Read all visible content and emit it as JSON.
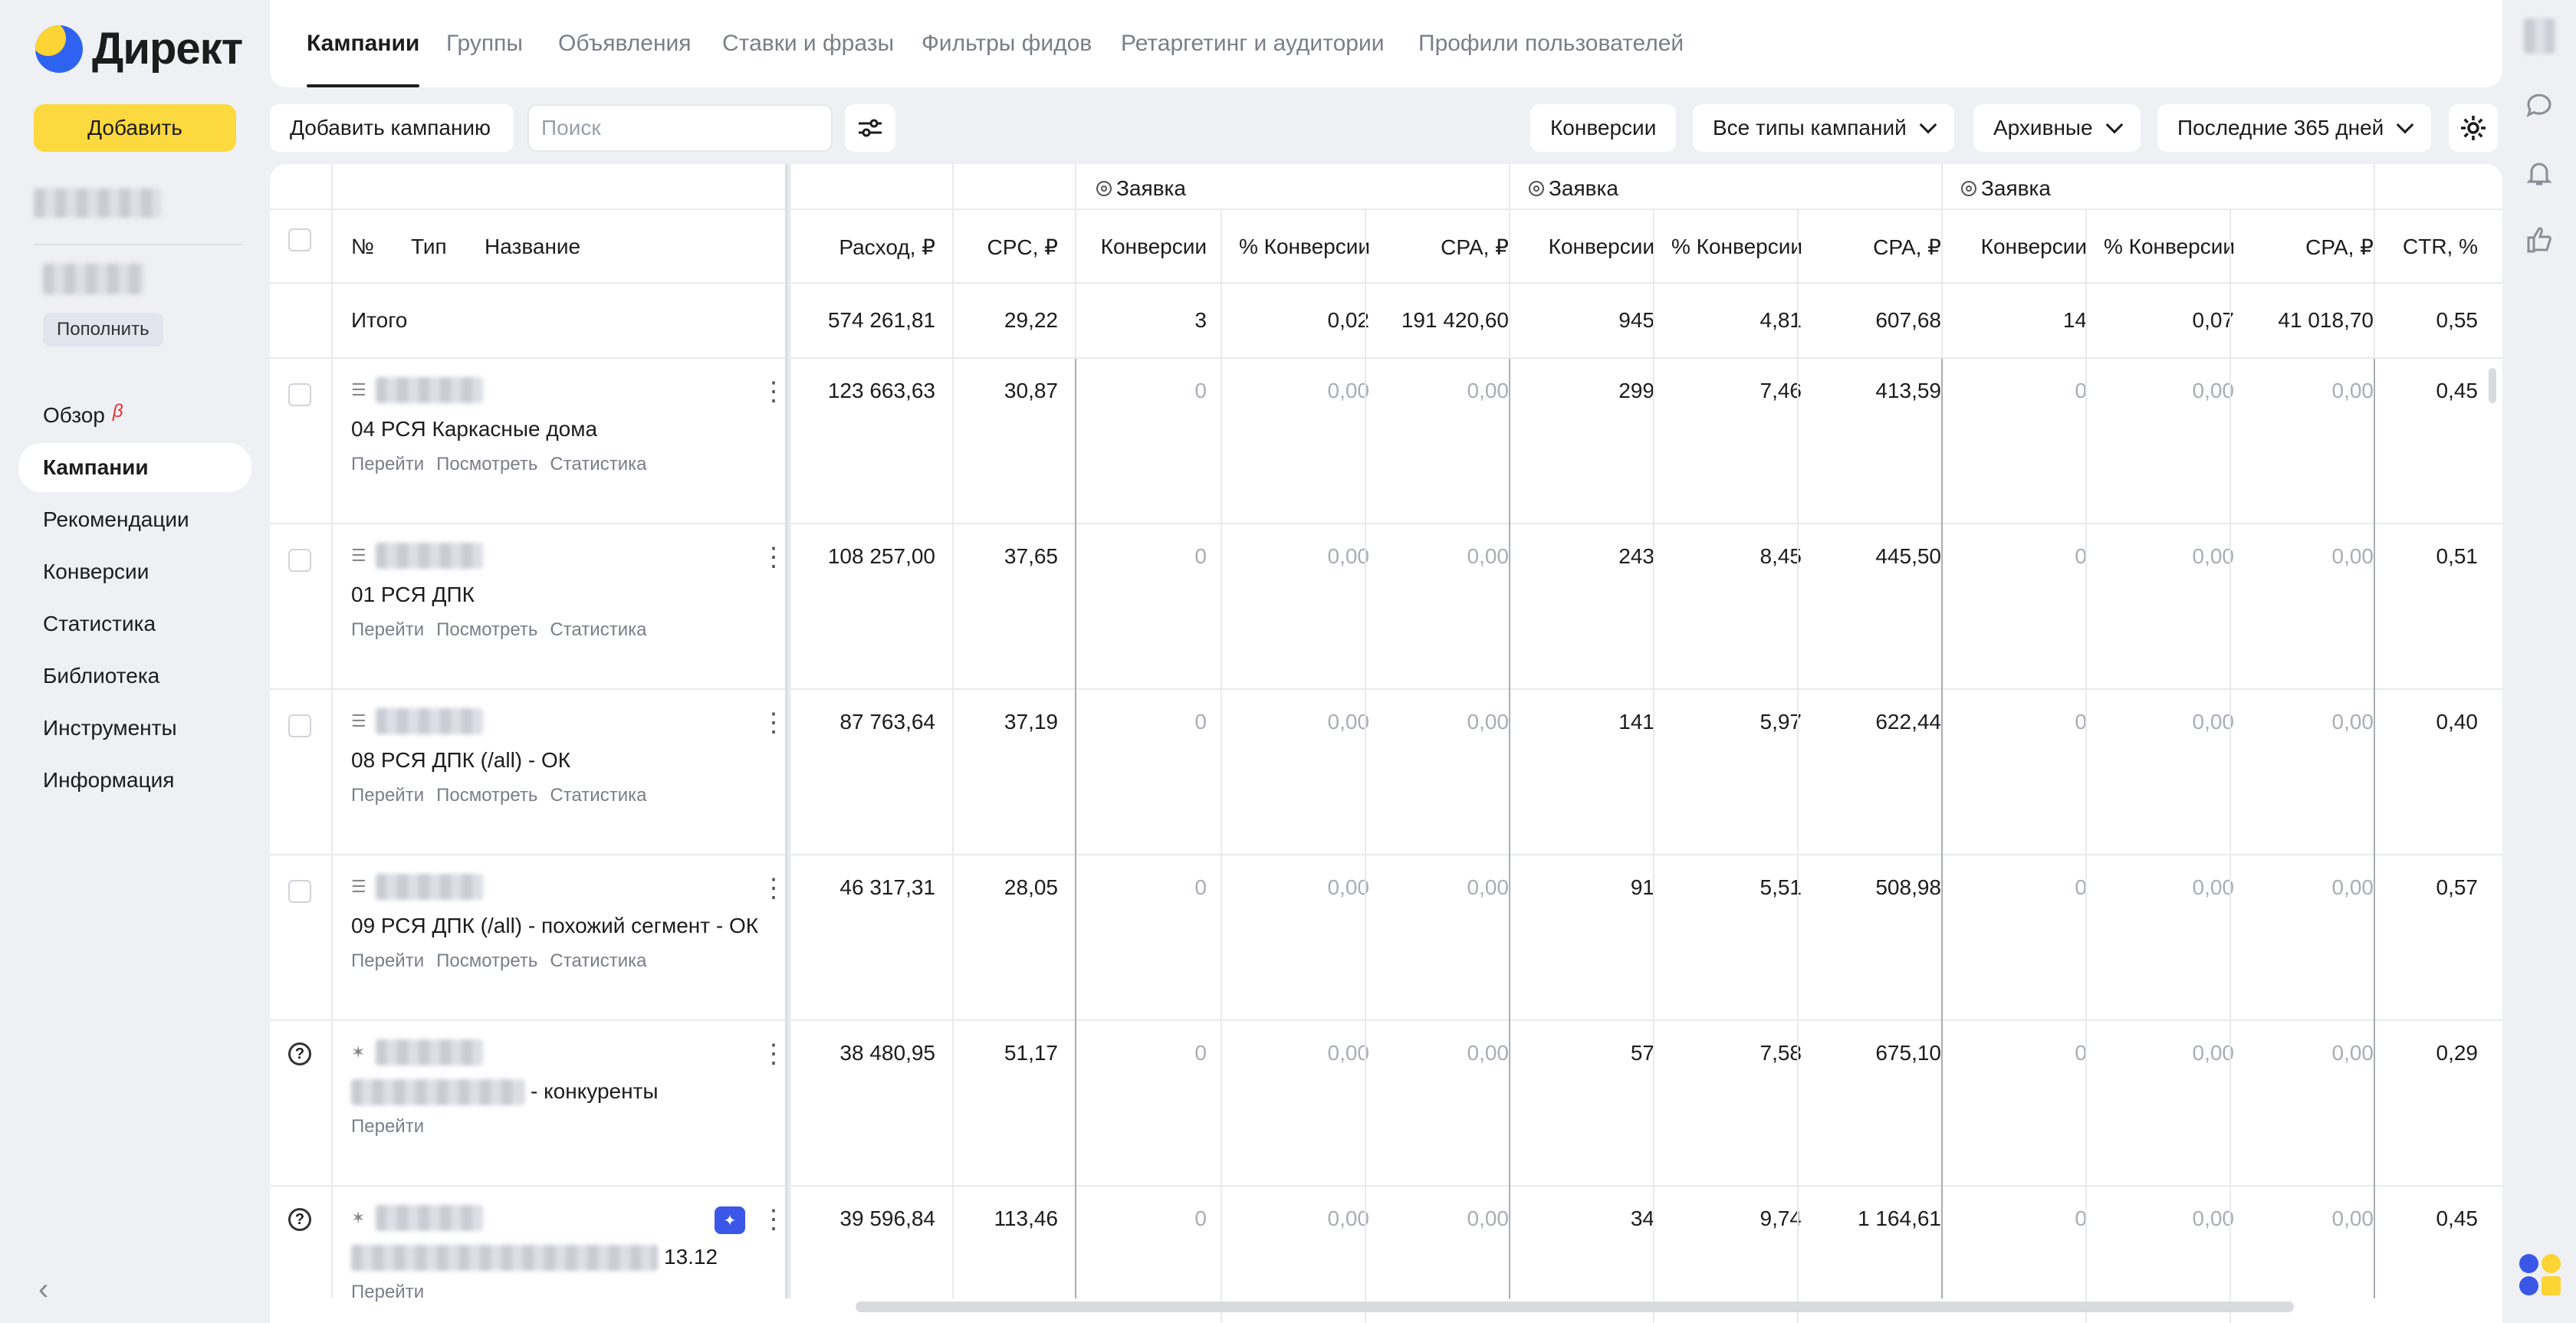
{
  "brand": {
    "name": "Директ"
  },
  "sidebar": {
    "add_label": "Добавить",
    "topup_label": "Пополнить",
    "nav": [
      {
        "label": "Обзор",
        "badge": "β"
      },
      {
        "label": "Кампании",
        "active": true
      },
      {
        "label": "Рекомендации"
      },
      {
        "label": "Конверсии"
      },
      {
        "label": "Статистика"
      },
      {
        "label": "Библиотека"
      },
      {
        "label": "Инструменты"
      },
      {
        "label": "Информация"
      }
    ]
  },
  "tabs": [
    "Кампании",
    "Группы",
    "Объявления",
    "Ставки и фразы",
    "Фильтры фидов",
    "Ретаргетинг и аудитории",
    "Профили пользователей"
  ],
  "toolbar": {
    "add_campaign": "Добавить кампанию",
    "search_placeholder": "Поиск",
    "conversions": "Конверсии",
    "types": "Все типы кампаний",
    "archived": "Архивные",
    "period": "Последние 365 дней"
  },
  "table": {
    "group_label": "Заявка",
    "headers": {
      "num": "№",
      "type": "Тип",
      "name": "Название",
      "spend": "Расход, ₽",
      "cpc": "CPC, ₽",
      "conv": "Конверсии",
      "conv_pct": "% Конверсии",
      "cpa": "CPA, ₽",
      "ctr": "CTR, %"
    },
    "total": {
      "label": "Итого",
      "spend": "574 261,81",
      "cpc": "29,22",
      "g1": [
        "3",
        "0,02",
        "191 420,60"
      ],
      "g2": [
        "945",
        "4,81",
        "607,68"
      ],
      "g3": [
        "14",
        "0,07",
        "41 018,70"
      ],
      "ctr": "0,55"
    },
    "rows": [
      {
        "name": "04 РСЯ Каркасные дома",
        "spend": "123 663,63",
        "cpc": "30,87",
        "g1": [
          "0",
          "0,00",
          "0,00"
        ],
        "g2": [
          "299",
          "7,46",
          "413,59"
        ],
        "g3": [
          "0",
          "0,00",
          "0,00"
        ],
        "ctr": "0,45"
      },
      {
        "name": "01 РСЯ ДПК",
        "spend": "108 257,00",
        "cpc": "37,65",
        "g1": [
          "0",
          "0,00",
          "0,00"
        ],
        "g2": [
          "243",
          "8,45",
          "445,50"
        ],
        "g3": [
          "0",
          "0,00",
          "0,00"
        ],
        "ctr": "0,51"
      },
      {
        "name": "08 РСЯ ДПК (/all) - ОК",
        "spend": "87 763,64",
        "cpc": "37,19",
        "g1": [
          "0",
          "0,00",
          "0,00"
        ],
        "g2": [
          "141",
          "5,97",
          "622,44"
        ],
        "g3": [
          "0",
          "0,00",
          "0,00"
        ],
        "ctr": "0,40"
      },
      {
        "name": "09 РСЯ ДПК (/all) - похожий сегмент - ОК",
        "spend": "46 317,31",
        "cpc": "28,05",
        "g1": [
          "0",
          "0,00",
          "0,00"
        ],
        "g2": [
          "91",
          "5,51",
          "508,98"
        ],
        "g3": [
          "0",
          "0,00",
          "0,00"
        ],
        "ctr": "0,57"
      },
      {
        "name": "- конкуренты",
        "spend": "38 480,95",
        "cpc": "51,17",
        "g1": [
          "0",
          "0,00",
          "0,00"
        ],
        "g2": [
          "57",
          "7,58",
          "675,10"
        ],
        "g3": [
          "0",
          "0,00",
          "0,00"
        ],
        "ctr": "0,29"
      },
      {
        "name": "13.12",
        "spend": "39 596,84",
        "cpc": "113,46",
        "g1": [
          "0",
          "0,00",
          "0,00"
        ],
        "g2": [
          "34",
          "9,74",
          "1 164,61"
        ],
        "g3": [
          "0",
          "0,00",
          "0,00"
        ],
        "ctr": "0,45"
      }
    ],
    "actions": {
      "go": "Перейти",
      "view": "Посмотреть",
      "stats": "Статистика"
    }
  }
}
